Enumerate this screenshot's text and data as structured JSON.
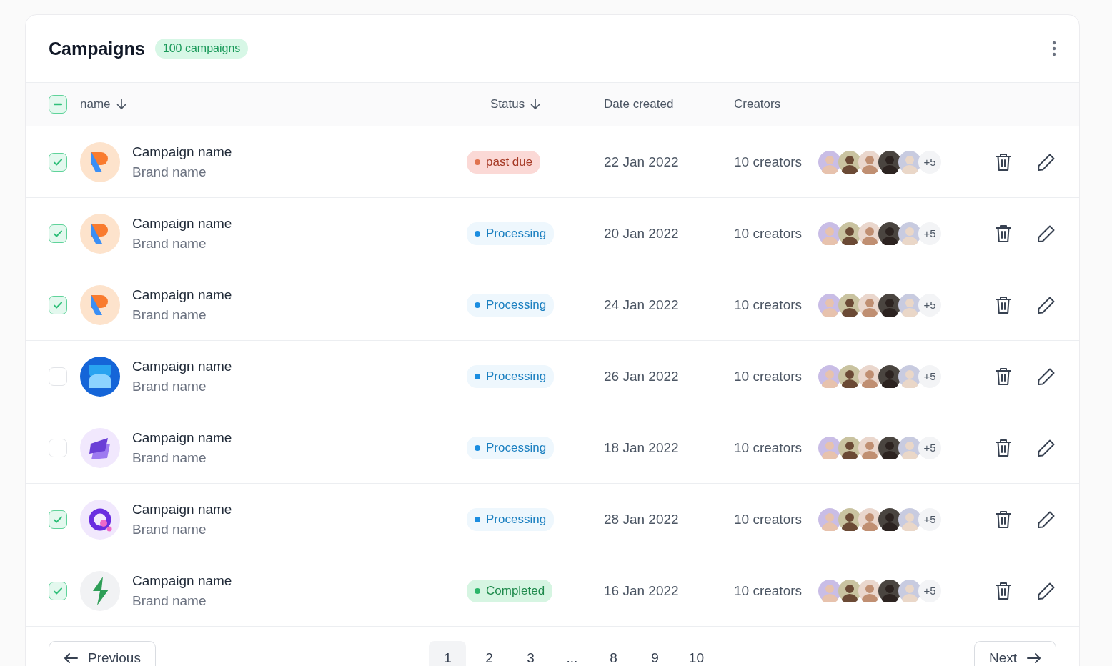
{
  "header": {
    "title": "Campaigns",
    "count_badge": "100 campaigns"
  },
  "table": {
    "select_all": {
      "indeterminate": true
    },
    "columns": [
      {
        "label": "name",
        "sorted": true
      },
      {
        "label": "Status",
        "sorted": true
      },
      {
        "label": "Date created",
        "sorted": false
      },
      {
        "label": "Creators",
        "sorted": false
      }
    ],
    "rows": [
      {
        "checked": true,
        "logo": {
          "kind": "r"
        },
        "name": "Campaign name",
        "brand": "Brand name",
        "status": {
          "kind": "past_due",
          "label": "past due"
        },
        "date": "22 Jan 2022",
        "creators": "10 creators",
        "more": "+5"
      },
      {
        "checked": true,
        "logo": {
          "kind": "r"
        },
        "name": "Campaign name",
        "brand": "Brand name",
        "status": {
          "kind": "processing",
          "label": "Processing"
        },
        "date": "20 Jan 2022",
        "creators": "10 creators",
        "more": "+5"
      },
      {
        "checked": true,
        "logo": {
          "kind": "r"
        },
        "name": "Campaign name",
        "brand": "Brand name",
        "status": {
          "kind": "processing",
          "label": "Processing"
        },
        "date": "24 Jan 2022",
        "creators": "10 creators",
        "more": "+5"
      },
      {
        "checked": false,
        "logo": {
          "kind": "hourglass"
        },
        "name": "Campaign name",
        "brand": "Brand name",
        "status": {
          "kind": "processing",
          "label": "Processing"
        },
        "date": "26 Jan 2022",
        "creators": "10 creators",
        "more": "+5"
      },
      {
        "checked": false,
        "logo": {
          "kind": "layers"
        },
        "name": "Campaign name",
        "brand": "Brand name",
        "status": {
          "kind": "processing",
          "label": "Processing"
        },
        "date": "18 Jan 2022",
        "creators": "10 creators",
        "more": "+5"
      },
      {
        "checked": true,
        "logo": {
          "kind": "ring"
        },
        "name": "Campaign name",
        "brand": "Brand name",
        "status": {
          "kind": "processing",
          "label": "Processing"
        },
        "date": "28 Jan 2022",
        "creators": "10 creators",
        "more": "+5"
      },
      {
        "checked": true,
        "logo": {
          "kind": "bolt"
        },
        "name": "Campaign name",
        "brand": "Brand name",
        "status": {
          "kind": "completed",
          "label": "Completed"
        },
        "date": "16 Jan 2022",
        "creators": "10 creators",
        "more": "+5"
      }
    ]
  },
  "pagination": {
    "previous": "Previous",
    "next": "Next",
    "pages": [
      {
        "label": "1",
        "selected": true
      },
      {
        "label": "2",
        "selected": false
      },
      {
        "label": "3",
        "selected": false
      },
      {
        "label": "...",
        "selected": false
      },
      {
        "label": "8",
        "selected": false
      },
      {
        "label": "9",
        "selected": false
      },
      {
        "label": "10",
        "selected": false
      }
    ]
  }
}
